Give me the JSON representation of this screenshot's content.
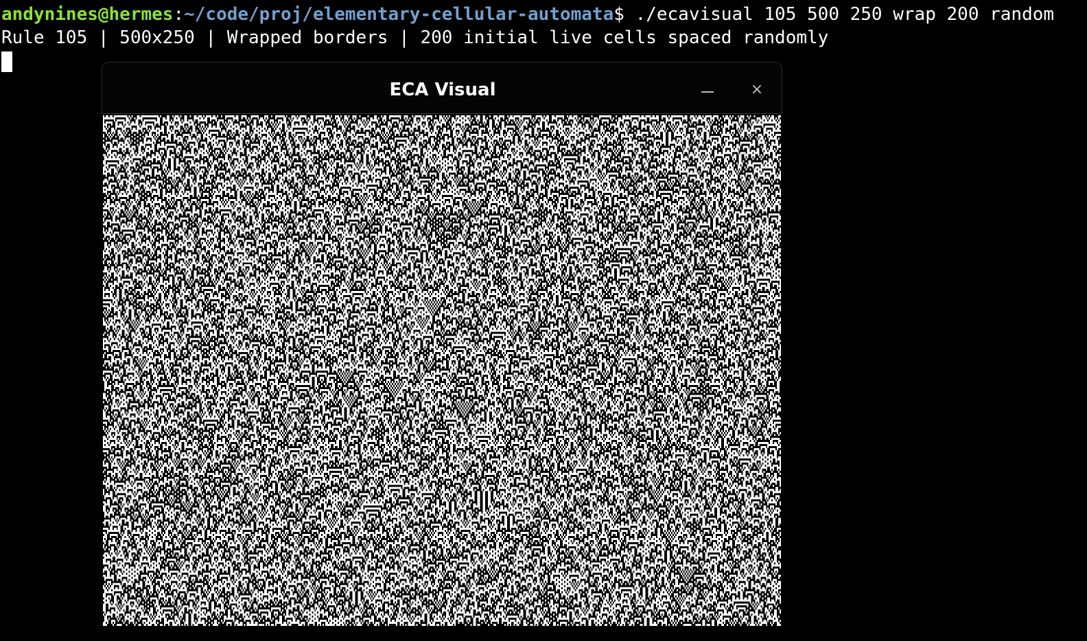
{
  "terminal": {
    "prompt_user": "andynines@hermes",
    "prompt_sep": ":",
    "prompt_path": "~/code/proj/elementary-cellular-automata",
    "prompt_symbol": "$ ",
    "command": "./ecavisual 105 500 250 wrap 200 random",
    "output": "Rule 105 | 500x250 | Wrapped borders | 200 initial live cells spaced randomly"
  },
  "window": {
    "title": "ECA Visual",
    "close_glyph": "×",
    "minimize_icon": "minimize-icon",
    "close_icon": "close-icon"
  },
  "automaton": {
    "rule": 105,
    "width": 500,
    "height": 250,
    "borders": "wrap",
    "initial_live_cells": 200,
    "spacing": "random",
    "live_color": "#000000",
    "dead_color": "#ffffff"
  },
  "colors": {
    "background": "#000000",
    "prompt_user": "#8ae234",
    "prompt_path": "#729fcf",
    "text": "#ffffff"
  }
}
